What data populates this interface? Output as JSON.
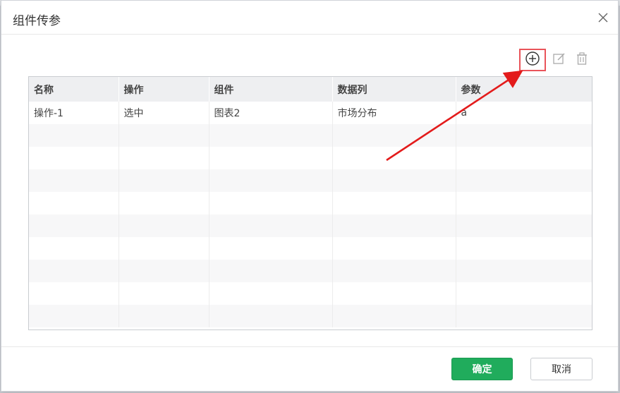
{
  "dialog": {
    "title": "组件传参",
    "close_icon": "close-icon"
  },
  "toolbar": {
    "add_icon": "plus-circle-icon",
    "edit_icon": "edit-icon",
    "delete_icon": "trash-icon",
    "highlight_color": "#e9545a"
  },
  "table": {
    "columns": [
      "名称",
      "操作",
      "组件",
      "数据列",
      "参数"
    ],
    "rows": [
      [
        "操作-1",
        "选中",
        "图表2",
        "市场分布",
        "a"
      ],
      [
        "",
        "",
        "",
        "",
        ""
      ],
      [
        "",
        "",
        "",
        "",
        ""
      ],
      [
        "",
        "",
        "",
        "",
        ""
      ],
      [
        "",
        "",
        "",
        "",
        ""
      ],
      [
        "",
        "",
        "",
        "",
        ""
      ],
      [
        "",
        "",
        "",
        "",
        ""
      ],
      [
        "",
        "",
        "",
        "",
        ""
      ],
      [
        "",
        "",
        "",
        "",
        ""
      ],
      [
        "",
        "",
        "",
        "",
        ""
      ]
    ]
  },
  "footer": {
    "ok_label": "确定",
    "cancel_label": "取消",
    "ok_color": "#20ac5c"
  },
  "annotation": {
    "arrow_color": "#e31b1b"
  }
}
